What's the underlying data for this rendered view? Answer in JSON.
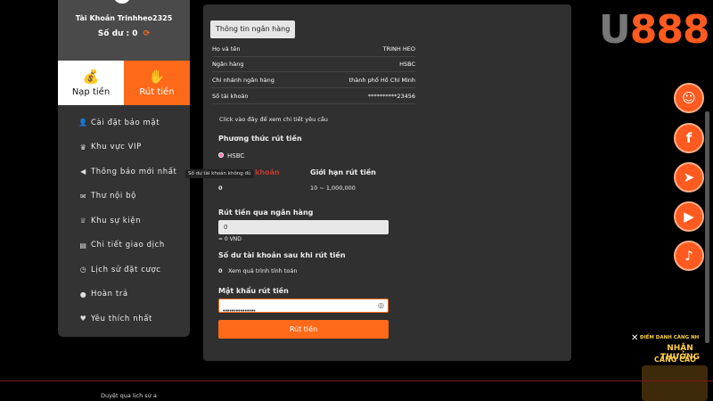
{
  "account": {
    "name": "Tài Khoản Trinhheo2325",
    "balance_label": "Số dư : 0",
    "refresh_icon": "refresh-icon"
  },
  "tabs": [
    {
      "label": "Nạp tiền",
      "icon": "money-bag-icon"
    },
    {
      "label": "Rút tiền",
      "icon": "hand-money-icon"
    }
  ],
  "menu": [
    {
      "label": "Cài đặt bảo mật",
      "icon": "user-lock-icon"
    },
    {
      "label": "Khu vực VIP",
      "icon": "crown-icon"
    },
    {
      "label": "Thông báo mới nhất",
      "icon": "megaphone-icon"
    },
    {
      "label": "Thư nội bộ",
      "icon": "mail-icon"
    },
    {
      "label": "Khu sự kiện",
      "icon": "trophy-icon"
    },
    {
      "label": "Chi tiết giao dịch",
      "icon": "receipt-icon"
    },
    {
      "label": "Lịch sử đặt cược",
      "icon": "history-icon"
    },
    {
      "label": "Hoàn trả",
      "icon": "coin-icon"
    },
    {
      "label": "Yêu thích nhất",
      "icon": "heart-icon"
    }
  ],
  "bank_info": {
    "section_title": "Thông tin ngân hàng",
    "rows": [
      {
        "label": "Họ và tên",
        "value": "TRINH HEO"
      },
      {
        "label": "Ngân hàng",
        "value": "HSBC"
      },
      {
        "label": "Chi nhánh ngân hàng",
        "value": "thành phố Hồ Chí Minh"
      },
      {
        "label": "Số tài khoản",
        "value": "**********23456"
      }
    ],
    "details_hint": "Click vào đây để xem chi tiết yêu cầu"
  },
  "withdraw": {
    "method_label": "Phương thức rút tiền",
    "method_option": "HSBC",
    "balance_col_label": "khoản",
    "balance_col_value": "0",
    "limit_label": "Giới hạn rút tiền",
    "limit_value": "10 ~ 1,000,000",
    "tooltip": "Số dư tài khoản không đủ",
    "amount_label": "Rút tiền qua ngân hàng",
    "amount_value": "0",
    "amount_converted": "= 0 VND",
    "after_balance_label": "Số dư tài khoản sau khi rút tiền",
    "after_balance_value": "0",
    "after_balance_hint": "Xem quá trình tính toán",
    "password_label": "Mật khẩu rút tiền",
    "password_value": "•••••••••••••••",
    "submit_label": "Rút tiền"
  },
  "brand": {
    "logo_prefix": "U",
    "logo_suffix": "888"
  },
  "social": [
    {
      "icon": "support-agent-icon",
      "glyph": "☺"
    },
    {
      "icon": "facebook-icon",
      "glyph": "f"
    },
    {
      "icon": "telegram-icon",
      "glyph": "➤"
    },
    {
      "icon": "youtube-icon",
      "glyph": "▶"
    },
    {
      "icon": "tiktok-icon",
      "glyph": "♪"
    }
  ],
  "promo": {
    "line1": "ĐIỂM DANH CÀNG NH",
    "line2": "NHẬN THƯỞNG",
    "line3": "CÀNG CAO"
  },
  "footer": {
    "text": "Duyệt qua lịch sử a"
  },
  "colors": {
    "accent": "#ff6a1a",
    "panel": "#303030",
    "sidebar": "#333333"
  }
}
